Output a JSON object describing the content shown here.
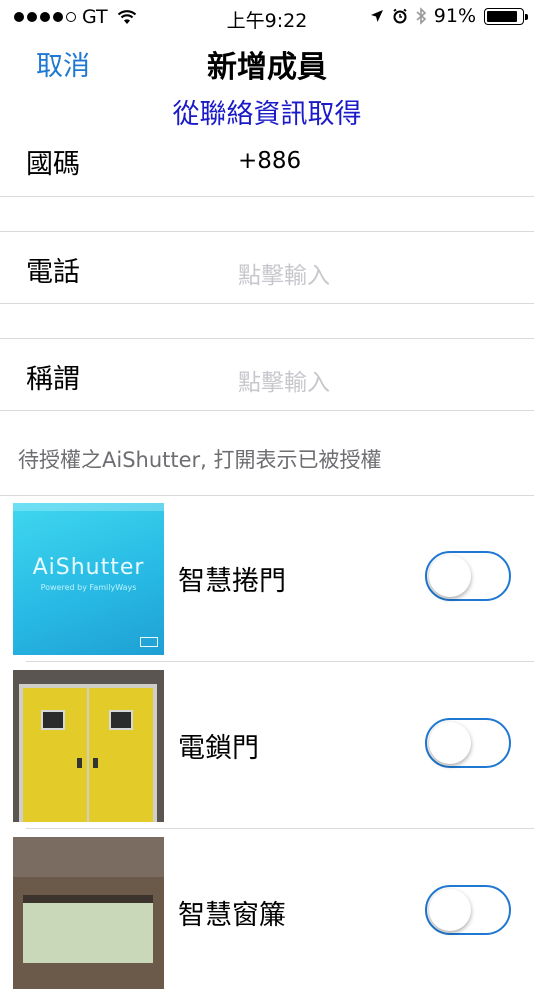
{
  "status_bar": {
    "carrier": "GT",
    "time": "上午9:22",
    "battery_pct": "91%",
    "battery_level": 0.91
  },
  "nav": {
    "cancel_label": "取消",
    "title": "新增成員"
  },
  "fetch_from_contacts_label": "從聯絡資訊取得",
  "form": {
    "country_code": {
      "label": "國碼",
      "value": "+886"
    },
    "phone": {
      "label": "電話",
      "placeholder": "點擊輸入"
    },
    "nickname": {
      "label": "稱謂",
      "placeholder": "點擊輸入"
    }
  },
  "section_header": "待授權之AiShutter, 打開表示已被授權",
  "devices": [
    {
      "name": "智慧捲門",
      "enabled": false,
      "thumb_text": "AiShutter",
      "thumb_subtext": "Powered by FamilyWays"
    },
    {
      "name": "電鎖門",
      "enabled": false
    },
    {
      "name": "智慧窗簾",
      "enabled": false
    }
  ],
  "colors": {
    "accent": "#1f78d1",
    "fetch_link": "#1a1ac8",
    "placeholder": "#c7c7cd",
    "separator": "#d9d9d9"
  }
}
